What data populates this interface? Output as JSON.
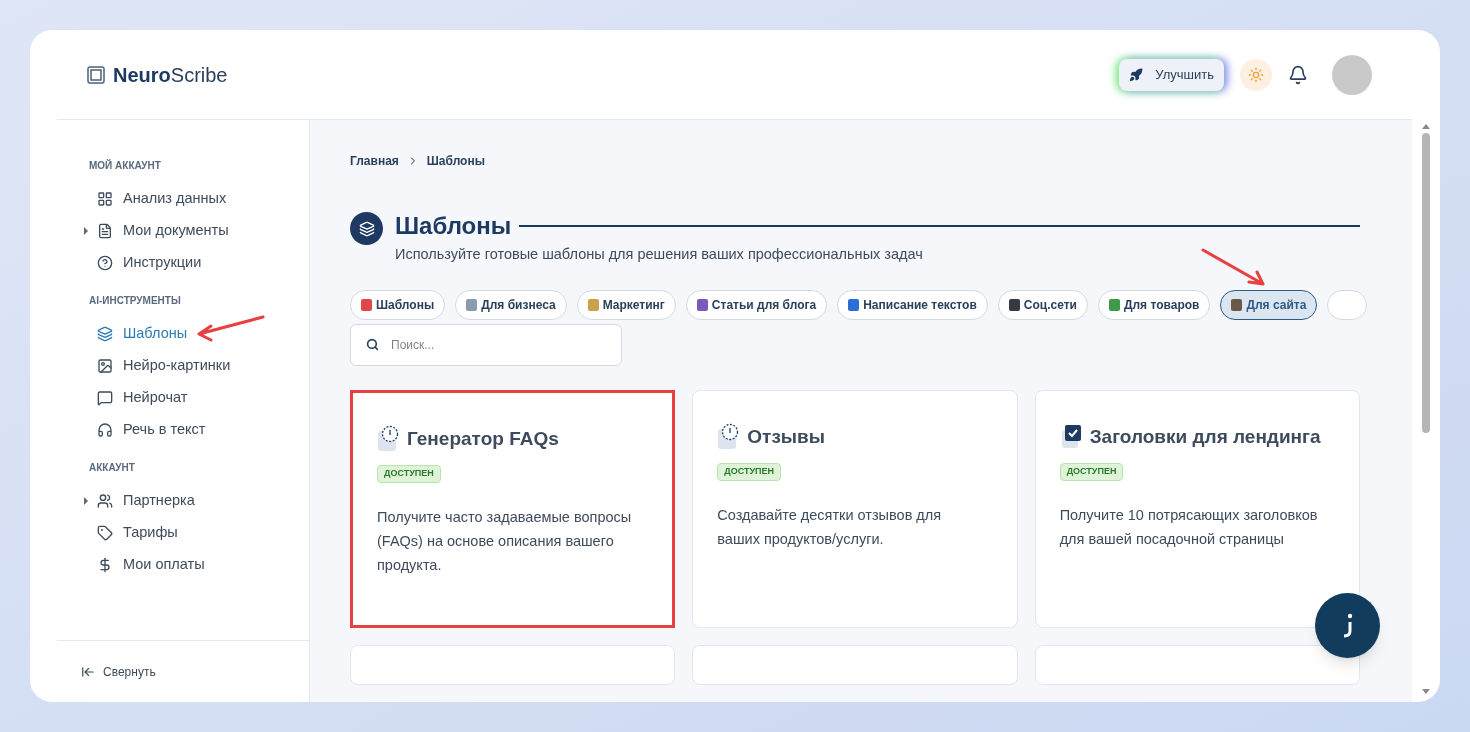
{
  "logo": {
    "bold": "Neuro",
    "rest": "Scribe"
  },
  "header": {
    "upgrade_label": "Улучшить"
  },
  "sidebar": {
    "sections": [
      {
        "title": "МОЙ АККАУНТ",
        "items": [
          {
            "label": "Анализ данных",
            "kind": "grid",
            "expandable": false,
            "selected": false
          },
          {
            "label": "Мои документы",
            "kind": "file",
            "expandable": true,
            "selected": false
          },
          {
            "label": "Инструкции",
            "kind": "help",
            "expandable": false,
            "selected": false
          }
        ]
      },
      {
        "title": "AI-ИНСТРУМЕНТЫ",
        "items": [
          {
            "label": "Шаблоны",
            "kind": "layers",
            "expandable": false,
            "selected": true
          },
          {
            "label": "Нейро-картинки",
            "kind": "image",
            "expandable": false,
            "selected": false
          },
          {
            "label": "Нейрочат",
            "kind": "chat",
            "expandable": false,
            "selected": false
          },
          {
            "label": "Речь в текст",
            "kind": "headphones",
            "expandable": false,
            "selected": false
          }
        ]
      },
      {
        "title": "АККАУНТ",
        "items": [
          {
            "label": "Партнерка",
            "kind": "users",
            "expandable": true,
            "selected": false
          },
          {
            "label": "Тарифы",
            "kind": "tag",
            "expandable": false,
            "selected": false
          },
          {
            "label": "Мои оплаты",
            "kind": "dollar",
            "expandable": false,
            "selected": false
          }
        ]
      }
    ],
    "collapse_label": "Свернуть"
  },
  "breadcrumb": [
    "Главная",
    "Шаблоны"
  ],
  "page": {
    "title": "Шаблоны",
    "subtitle": "Используйте готовые шаблоны для решения ваших профессиональных задач"
  },
  "categories": [
    {
      "label": "Шаблоны",
      "color": "#e04848",
      "selected": false
    },
    {
      "label": "Для бизнеса",
      "color": "#8a9bb0",
      "selected": false
    },
    {
      "label": "Маркетинг",
      "color": "#c9a24a",
      "selected": false
    },
    {
      "label": "Статьи для блога",
      "color": "#7a5ab8",
      "selected": false
    },
    {
      "label": "Написание текстов",
      "color": "#2a6fd6",
      "selected": false
    },
    {
      "label": "Соц.сети",
      "color": "#333a45",
      "selected": false
    },
    {
      "label": "Для товаров",
      "color": "#3f9a4a",
      "selected": false
    },
    {
      "label": "Для сайта",
      "color": "#6b5a4a",
      "selected": true
    }
  ],
  "search": {
    "placeholder": "Поиск..."
  },
  "templates": [
    {
      "title": "Генератор FAQs",
      "kind": "clock",
      "badge": "ДОСТУПЕН",
      "description": "Получите часто задаваемые вопросы (FAQs) на основе описания вашего продукта.",
      "highlighted": true
    },
    {
      "title": "Отзывы",
      "kind": "clock",
      "badge": "ДОСТУПЕН",
      "description": "Создавайте десятки отзывов для ваших продуктов/услуги.",
      "highlighted": false
    },
    {
      "title": "Заголовки для лендинга",
      "kind": "check",
      "badge": "ДОСТУПЕН",
      "description": "Получите 10 потрясающих заголовков для вашей посадочной страницы",
      "highlighted": false
    }
  ]
}
